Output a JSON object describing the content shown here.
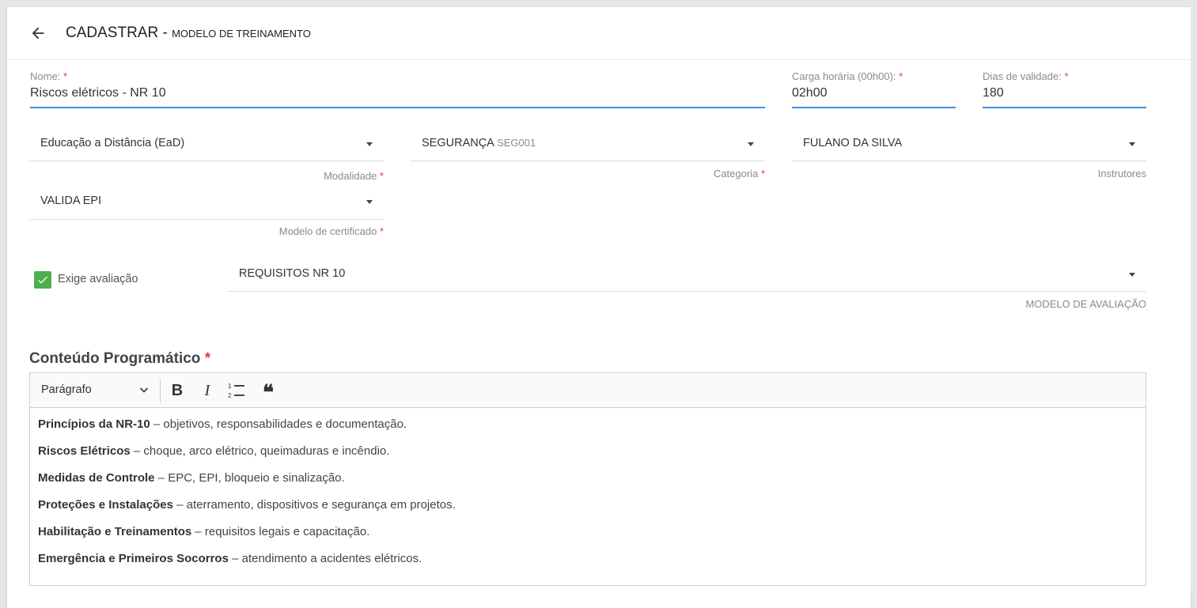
{
  "header": {
    "title": "CADASTRAR - ",
    "subtitle": "MODELO DE TREINAMENTO"
  },
  "fields": {
    "nome": {
      "label": "Nome:",
      "required_mark": "*",
      "value": "Riscos elétricos - NR 10"
    },
    "carga": {
      "label": "Carga horária (00h00):",
      "required_mark": "*",
      "value": "02h00"
    },
    "dias": {
      "label": "Dias de validade:",
      "required_mark": "*",
      "value": "180"
    }
  },
  "selects": {
    "modalidade": {
      "value": "Educação a Distância (EaD)",
      "hint": "Modalidade",
      "required_mark": "*"
    },
    "categoria": {
      "value": "SEGURANÇA",
      "code": "SEG001",
      "hint": "Categoria",
      "required_mark": "*"
    },
    "instrutores": {
      "value": "FULANO DA SILVA",
      "hint": "Instrutores"
    },
    "certificado": {
      "value": "VALIDA EPI",
      "hint": "Modelo de certificado",
      "required_mark": "*"
    },
    "avaliacao": {
      "value": "REQUISITOS NR 10",
      "hint": "MODELO DE AVALIAÇÃO"
    }
  },
  "exige_avaliacao": {
    "label": "Exige avaliação",
    "checked": true
  },
  "conteudo": {
    "title": "Conteúdo Programático",
    "required_mark": "*",
    "toolbar": {
      "paragraph": "Parágrafo"
    },
    "items": [
      {
        "bold": "Princípios da NR-10",
        "text": " – objetivos, responsabilidades e documentação."
      },
      {
        "bold": "Riscos Elétricos",
        "text": " – choque, arco elétrico, queimaduras e incêndio."
      },
      {
        "bold": "Medidas de Controle",
        "text": " – EPC, EPI, bloqueio e sinalização."
      },
      {
        "bold": "Proteções e Instalações",
        "text": " – aterramento, dispositivos e segurança em projetos."
      },
      {
        "bold": "Habilitação e Treinamentos",
        "text": " – requisitos legais e capacitação."
      },
      {
        "bold": "Emergência e Primeiros Socorros",
        "text": " – atendimento a acidentes elétricos."
      }
    ]
  }
}
